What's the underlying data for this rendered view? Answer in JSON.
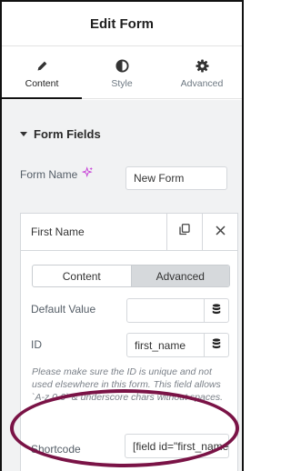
{
  "header": {
    "title": "Edit Form"
  },
  "tabs": [
    {
      "label": "Content",
      "icon": "pencil-icon",
      "active": true
    },
    {
      "label": "Style",
      "icon": "half-circle-icon",
      "active": false
    },
    {
      "label": "Advanced",
      "icon": "gear-icon",
      "active": false
    }
  ],
  "section": {
    "title": "Form Fields"
  },
  "form_name": {
    "label": "Form Name",
    "value": "New Form"
  },
  "field_item": {
    "title": "First Name",
    "switch": {
      "content": "Content",
      "advanced": "Advanced",
      "selected": "Advanced"
    },
    "default_value": {
      "label": "Default Value",
      "value": ""
    },
    "id_field": {
      "label": "ID",
      "value": "first_name"
    },
    "help_text": "Please make sure the ID is unique and not used elsewhere in this form. This field allows `A-z 0-9` & underscore chars without spaces.",
    "shortcode": {
      "label": "Shortcode",
      "value": "[field id=\"first_name\"]"
    }
  },
  "colors": {
    "highlight": "#7a1346",
    "panel_bg": "#f1f2f3",
    "sparkle": "#c53bd6"
  }
}
